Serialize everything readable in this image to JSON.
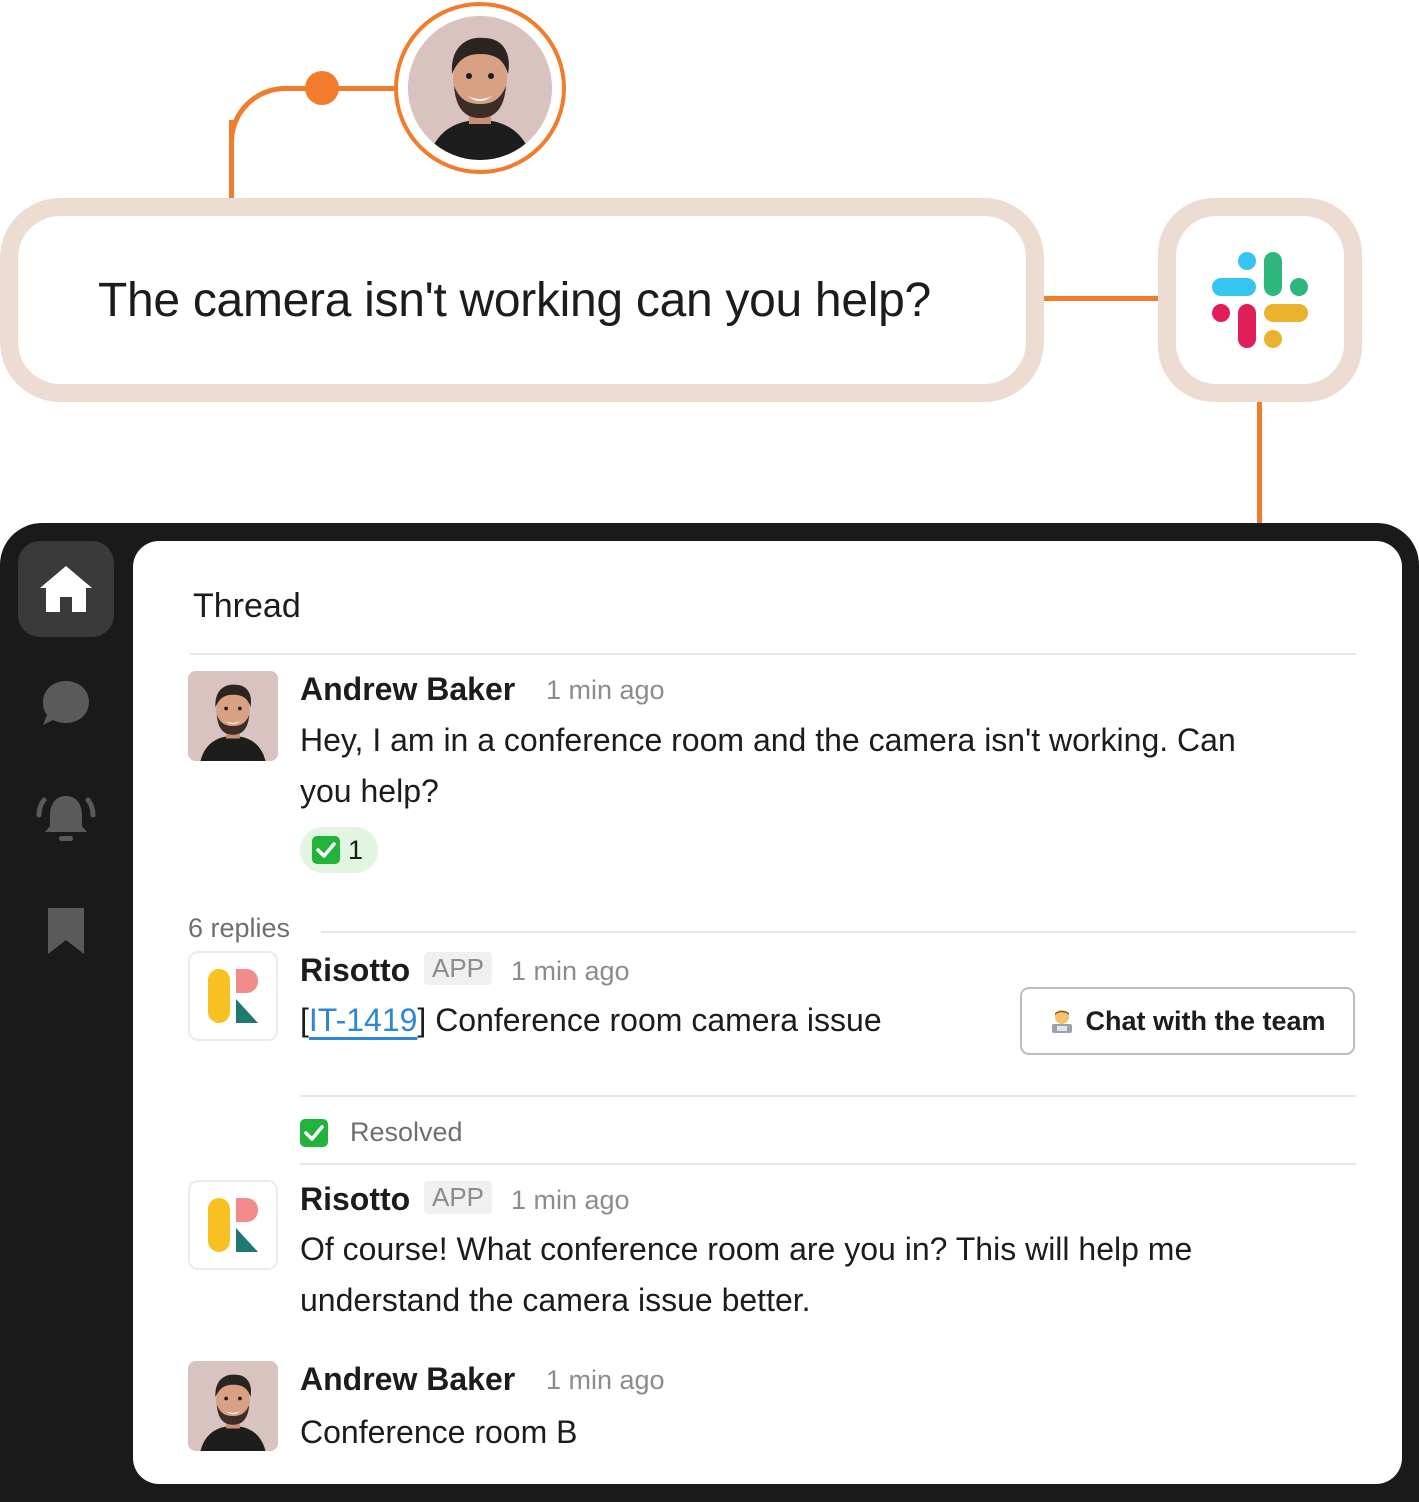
{
  "question": {
    "text": "The camera isn't working can you help?"
  },
  "slack": {
    "icon": "slack-logo-icon"
  },
  "rail": {
    "items": [
      {
        "name": "home",
        "icon": "home-icon",
        "active": true
      },
      {
        "name": "messages",
        "icon": "chat-bubble-icon",
        "active": false
      },
      {
        "name": "alerts",
        "icon": "bell-icon",
        "active": false
      },
      {
        "name": "saved",
        "icon": "bookmark-icon",
        "active": false
      }
    ]
  },
  "thread": {
    "title": "Thread",
    "original": {
      "author": "Andrew Baker",
      "time": "1 min ago",
      "line1": "Hey, I am in a conference room and the camera isn't working. Can",
      "line2": "you help?",
      "reaction": {
        "emoji": "white-check-mark",
        "count": "1"
      }
    },
    "replies_label": "6 replies",
    "reply1": {
      "author": "Risotto",
      "badge": "APP",
      "time": "1 min ago",
      "bracket_open": "[",
      "ticket": "IT-1419",
      "bracket_close": "]",
      "summary": " Conference room camera issue",
      "button_label": "Chat with the team",
      "status": "Resolved"
    },
    "reply2": {
      "author": "Risotto",
      "badge": "APP",
      "time": "1 min ago",
      "line1": "Of course! What conference room are you in? This will help me",
      "line2": "understand the camera issue better."
    },
    "reply3": {
      "author": "Andrew Baker",
      "time": "1 min ago",
      "text": "Conference room B"
    }
  },
  "colors": {
    "accent": "#f07c2c",
    "frame": "#1a1a1a",
    "link": "#2f86d6",
    "resolved": "#21b33c",
    "risotto_yellow": "#f8c021",
    "risotto_pink": "#f28b8b",
    "risotto_teal": "#1e7a70"
  }
}
